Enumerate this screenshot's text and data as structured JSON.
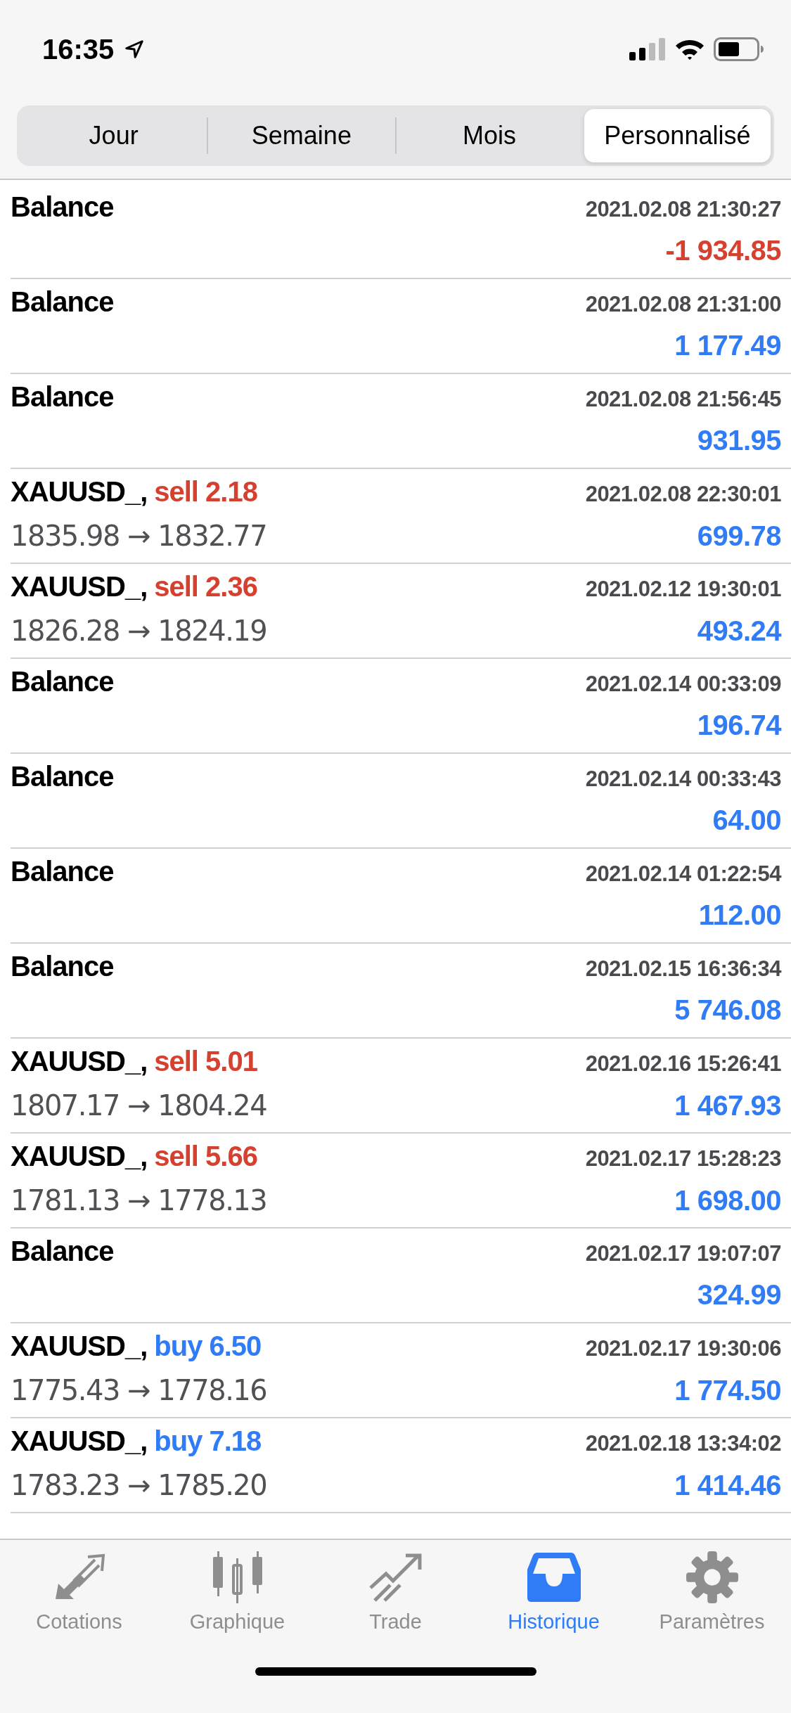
{
  "status_bar": {
    "time": "16:35"
  },
  "segments": [
    {
      "label": "Jour",
      "selected": false
    },
    {
      "label": "Semaine",
      "selected": false
    },
    {
      "label": "Mois",
      "selected": false
    },
    {
      "label": "Personnalisé",
      "selected": true
    }
  ],
  "rows": [
    {
      "kind": "balance",
      "title": "Balance",
      "time": "2021.02.08 21:30:27",
      "amount": "-1 934.85",
      "negative": true
    },
    {
      "kind": "balance",
      "title": "Balance",
      "time": "2021.02.08 21:31:00",
      "amount": "1 177.49",
      "negative": false
    },
    {
      "kind": "balance",
      "title": "Balance",
      "time": "2021.02.08 21:56:45",
      "amount": "931.95",
      "negative": false
    },
    {
      "kind": "trade",
      "title": "XAUUSD_,",
      "action": "sell 2.18",
      "color": "#d6402f",
      "prices": "1835.98 → 1832.77",
      "time": "2021.02.08 22:30:01",
      "amount": "699.78",
      "negative": false
    },
    {
      "kind": "trade",
      "title": "XAUUSD_,",
      "action": "sell 2.36",
      "color": "#d6402f",
      "prices": "1826.28 → 1824.19",
      "time": "2021.02.12 19:30:01",
      "amount": "493.24",
      "negative": false
    },
    {
      "kind": "balance",
      "title": "Balance",
      "time": "2021.02.14 00:33:09",
      "amount": "196.74",
      "negative": false
    },
    {
      "kind": "balance",
      "title": "Balance",
      "time": "2021.02.14 00:33:43",
      "amount": "64.00",
      "negative": false
    },
    {
      "kind": "balance",
      "title": "Balance",
      "time": "2021.02.14 01:22:54",
      "amount": "112.00",
      "negative": false
    },
    {
      "kind": "balance",
      "title": "Balance",
      "time": "2021.02.15 16:36:34",
      "amount": "5 746.08",
      "negative": false
    },
    {
      "kind": "trade",
      "title": "XAUUSD_,",
      "action": "sell 5.01",
      "color": "#d6402f",
      "prices": "1807.17 → 1804.24",
      "time": "2021.02.16 15:26:41",
      "amount": "1 467.93",
      "negative": false
    },
    {
      "kind": "trade",
      "title": "XAUUSD_,",
      "action": "sell 5.66",
      "color": "#d6402f",
      "prices": "1781.13 → 1778.13",
      "time": "2021.02.17 15:28:23",
      "amount": "1 698.00",
      "negative": false
    },
    {
      "kind": "balance",
      "title": "Balance",
      "time": "2021.02.17 19:07:07",
      "amount": "324.99",
      "negative": false
    },
    {
      "kind": "trade",
      "title": "XAUUSD_,",
      "action": "buy 6.50",
      "color": "#2f7cf6",
      "prices": "1775.43 → 1778.16",
      "time": "2021.02.17 19:30:06",
      "amount": "1 774.50",
      "negative": false
    },
    {
      "kind": "trade",
      "title": "XAUUSD_,",
      "action": "buy 7.18",
      "color": "#2f7cf6",
      "prices": "1783.23 → 1785.20",
      "time": "2021.02.18 13:34:02",
      "amount": "1 414.46",
      "negative": false
    }
  ],
  "tab_bar": [
    {
      "label": "Cotations",
      "selected": false
    },
    {
      "label": "Graphique",
      "selected": false
    },
    {
      "label": "Trade",
      "selected": false
    },
    {
      "label": "Historique",
      "selected": true
    },
    {
      "label": "Paramètres",
      "selected": false
    }
  ]
}
